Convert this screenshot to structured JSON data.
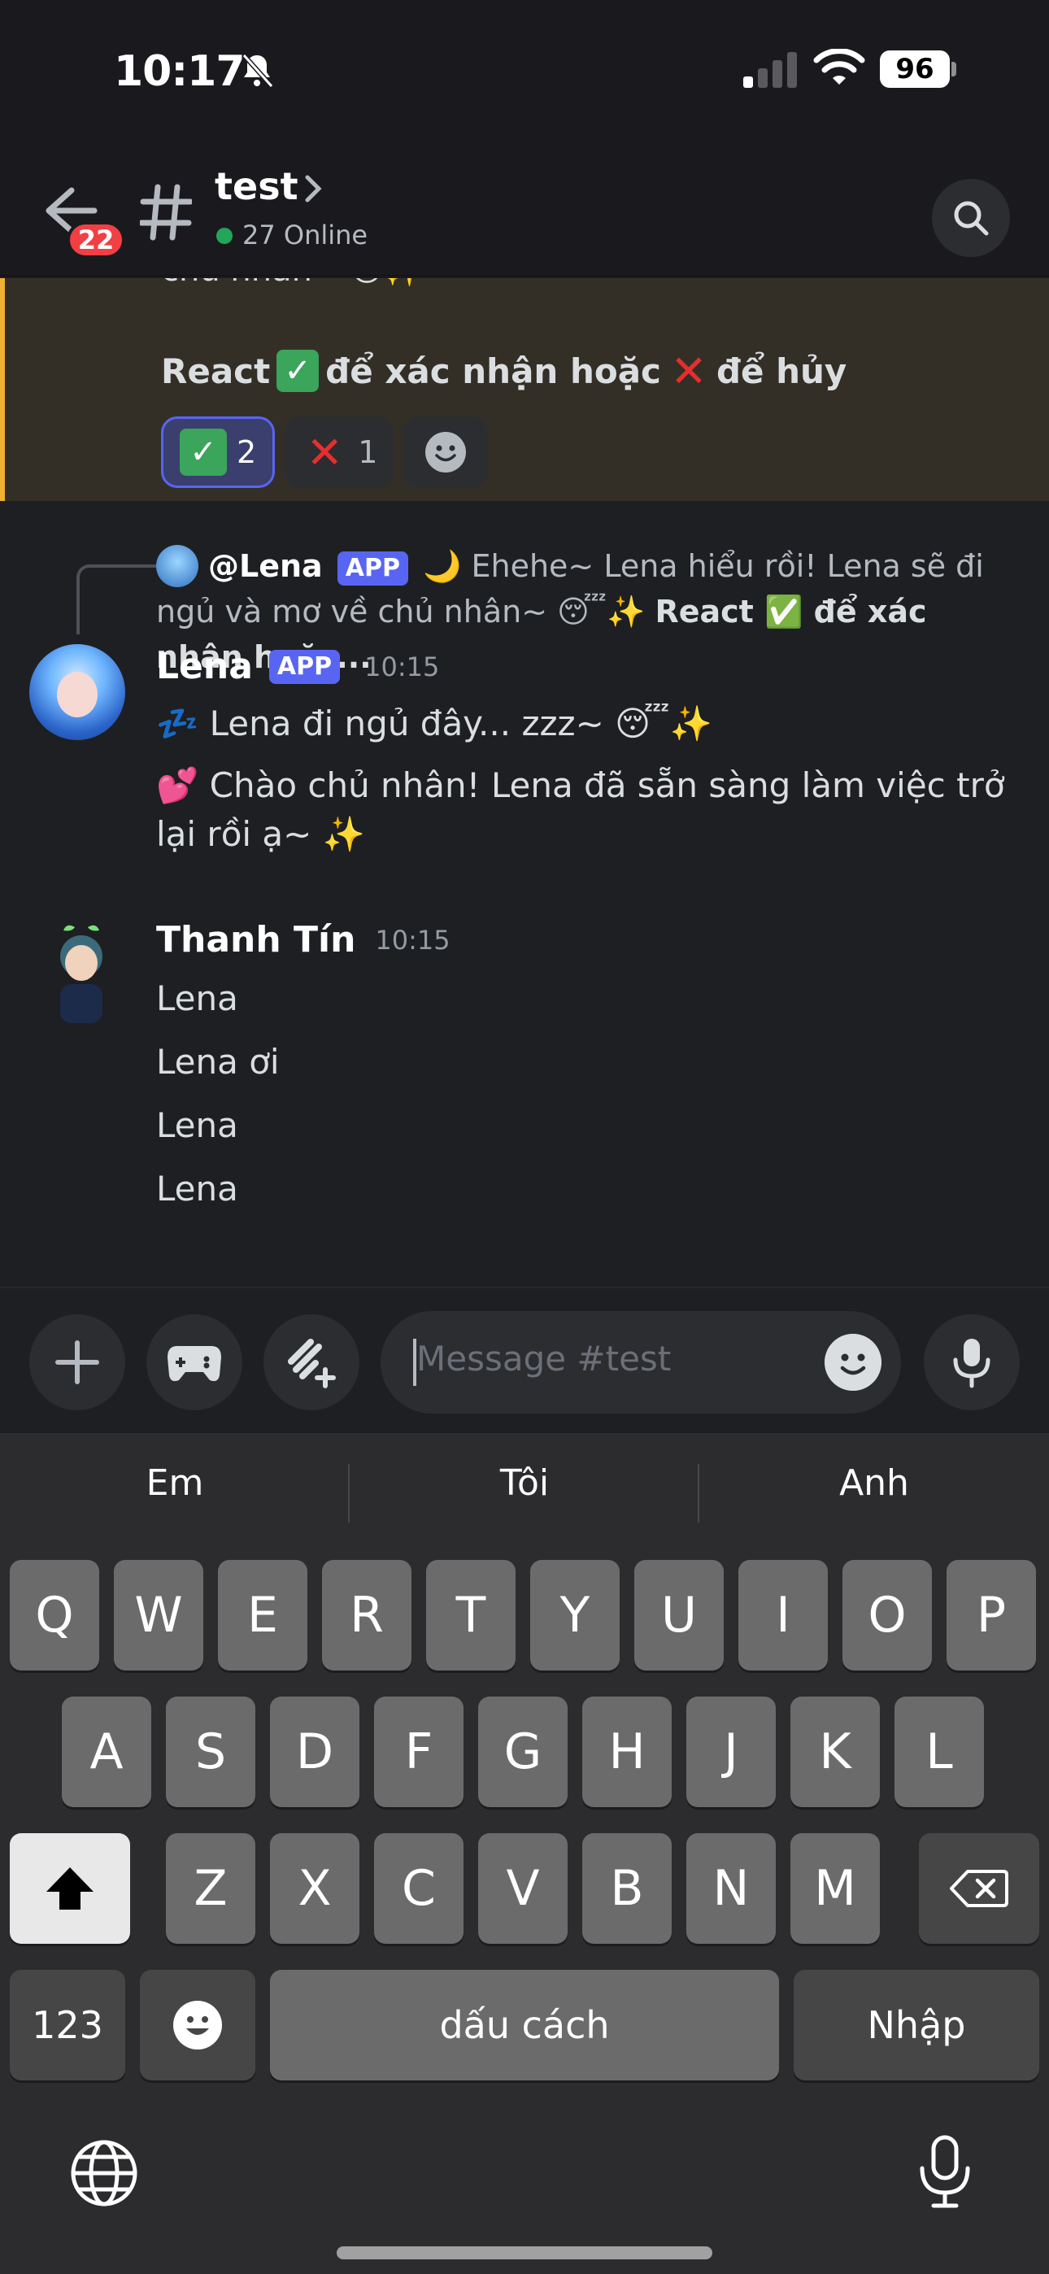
{
  "status": {
    "time": "10:17",
    "battery": "96"
  },
  "header": {
    "back_badge": "22",
    "channel_name": "test",
    "online": "27 Online"
  },
  "highlight": {
    "partial": "chủ nhân~",
    "react_prefix": "React",
    "react_confirm": "để xác nhận hoặc",
    "react_cancel": "để hủy",
    "reaction_check_count": "2",
    "reaction_x_count": "1"
  },
  "reply": {
    "name": "@Lena",
    "app": "APP",
    "text": "🌙 Ehehe~ Lena hiểu rồi! Lena sẽ đi ngủ và mơ về chủ nhân~ 😴✨",
    "bold": "React ✅ để xác nhận hoặc..."
  },
  "messages": [
    {
      "author": "Lena",
      "app": "APP",
      "time": "10:15",
      "lines": [
        "💤 Lena đi ngủ đây... zzz~ 😴✨",
        "💕 Chào chủ nhân! Lena đã sẵn sàng làm việc trở lại rồi ạ~ ✨"
      ]
    },
    {
      "author": "Thanh Tín",
      "time": "10:15",
      "lines": [
        "Lena",
        "Lena ơi",
        "Lena",
        "Lena"
      ]
    }
  ],
  "composer": {
    "placeholder": "Message #test"
  },
  "keyboard": {
    "suggestions": [
      "Em",
      "Tôi",
      "Anh"
    ],
    "row1": [
      "Q",
      "W",
      "E",
      "R",
      "T",
      "Y",
      "U",
      "I",
      "O",
      "P"
    ],
    "row2": [
      "A",
      "S",
      "D",
      "F",
      "G",
      "H",
      "J",
      "K",
      "L"
    ],
    "row3": [
      "Z",
      "X",
      "C",
      "V",
      "B",
      "N",
      "M"
    ],
    "numbers": "123",
    "space": "dấu cách",
    "return": "Nhập"
  },
  "colors": {
    "accent": "#5865f2",
    "online": "#23a55a",
    "badge": "#f23f43",
    "highlight_bar": "#f0b232"
  },
  "icons": [
    "bell-off-icon",
    "signal-icon",
    "wifi-icon",
    "back-arrow-icon",
    "hash-icon",
    "chevron-right-icon",
    "search-icon",
    "plus-icon",
    "gamepad-icon",
    "apps-icon",
    "emoji-icon",
    "mic-icon",
    "shift-icon",
    "backspace-icon",
    "globe-icon"
  ]
}
